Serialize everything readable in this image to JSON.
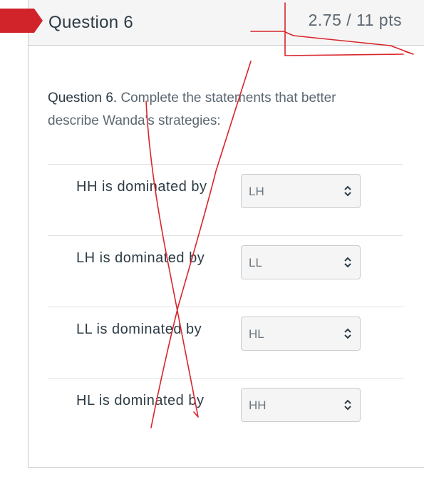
{
  "question": {
    "title": "Question 6",
    "points": "2.75 / 11 pts",
    "prompt_lead": "Question 6.",
    "prompt_text": "Complete the statements that better describe Wanda's strategies:"
  },
  "rows": [
    {
      "label": "HH is dominated by",
      "selected": "LH"
    },
    {
      "label": "LH is dominated by",
      "selected": "LL"
    },
    {
      "label": "LL is dominated by",
      "selected": "HL"
    },
    {
      "label": "HL is dominated by",
      "selected": "HH"
    }
  ],
  "colors": {
    "flag": "#d0232a",
    "annotation": "#d9252b",
    "header_bg": "#f5f5f5",
    "text": "#2d3b45"
  },
  "icons": {
    "select": "up-down-chevron-icon",
    "flag": "flag-icon"
  }
}
